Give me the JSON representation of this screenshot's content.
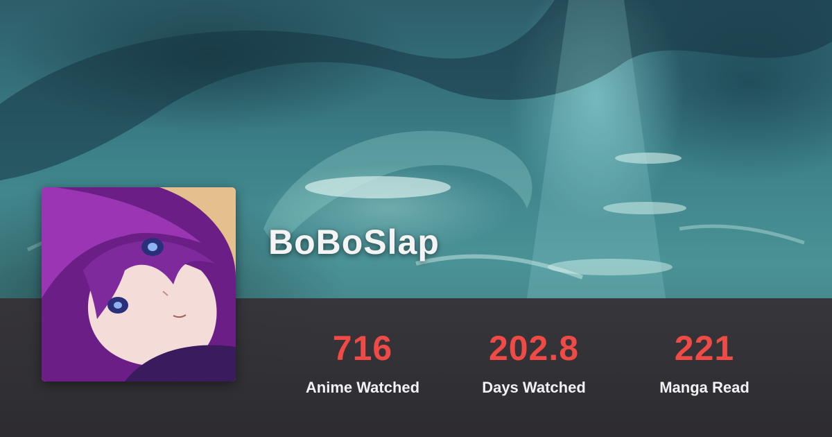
{
  "profile": {
    "username": "BoBoSlap",
    "avatar": "avatar-image"
  },
  "stats": [
    {
      "value": "716",
      "label": "Anime Watched"
    },
    {
      "value": "202.8",
      "label": "Days Watched"
    },
    {
      "value": "221",
      "label": "Manga Read"
    }
  ],
  "colors": {
    "stat_value": "#ef4a46",
    "stat_label": "#f2f2f2",
    "band": "#2e2a2e",
    "banner": "#3c8088"
  }
}
